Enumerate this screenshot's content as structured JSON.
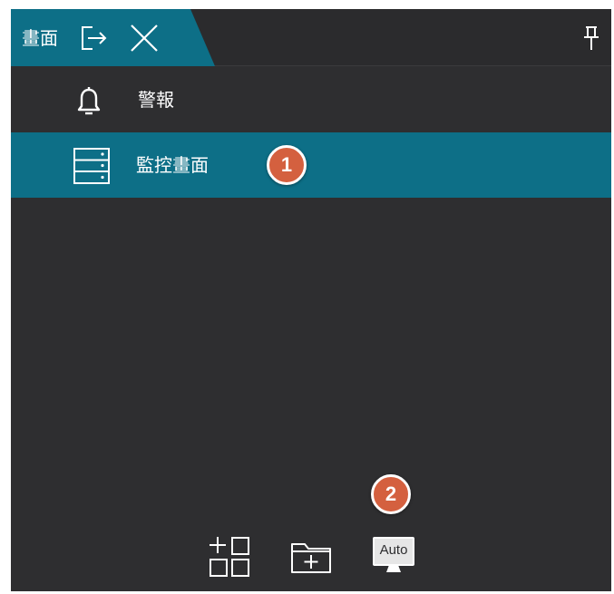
{
  "tab": {
    "title": "畫面"
  },
  "menu": {
    "items": [
      {
        "label": "警報",
        "icon": "bell-icon"
      },
      {
        "label": "監控畫面",
        "icon": "server-rack-icon",
        "selected": true
      }
    ]
  },
  "callouts": [
    {
      "number": "1"
    },
    {
      "number": "2"
    }
  ],
  "toolbar": {
    "buttons": [
      {
        "icon": "add-layout-icon"
      },
      {
        "icon": "add-folder-icon"
      },
      {
        "icon": "auto-display-icon",
        "text": "Auto"
      }
    ]
  },
  "colors": {
    "accent": "#0d6f87",
    "panel": "#2e2e30",
    "callout": "#d4603f"
  }
}
